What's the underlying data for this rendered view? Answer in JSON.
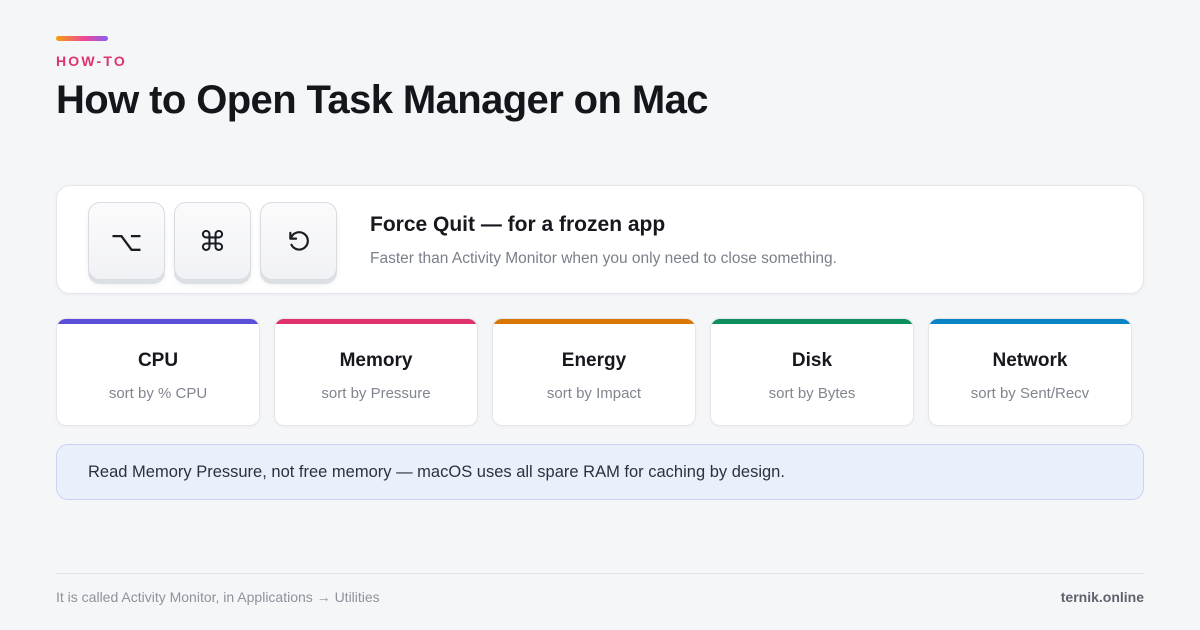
{
  "header": {
    "eyebrow": "HOW-TO",
    "title": "How to Open Task Manager on Mac"
  },
  "shortcut": {
    "keys": [
      {
        "icon": "option-key-icon",
        "glyph": "⌥"
      },
      {
        "icon": "command-key-icon",
        "glyph": "⌘"
      },
      {
        "icon": "escape-key-icon",
        "glyph": "⎋"
      }
    ],
    "title": "Force Quit — for a frozen app",
    "description": "Faster than Activity Monitor when you only need to close something."
  },
  "tabs": [
    {
      "name": "CPU",
      "sort": "sort by % CPU",
      "color": "#5b4fd9"
    },
    {
      "name": "Memory",
      "sort": "sort by Pressure",
      "color": "#e0336e"
    },
    {
      "name": "Energy",
      "sort": "sort by Impact",
      "color": "#d97706"
    },
    {
      "name": "Disk",
      "sort": "sort by Bytes",
      "color": "#0d8f5f"
    },
    {
      "name": "Network",
      "sort": "sort by Sent/Recv",
      "color": "#0b84c6"
    }
  ],
  "tip": {
    "text": "Read Memory Pressure, not free memory — macOS uses all spare RAM for caching by design."
  },
  "footer": {
    "note": "It is called Activity Monitor, in Applications → Utilities",
    "brand": "ternik.online"
  }
}
